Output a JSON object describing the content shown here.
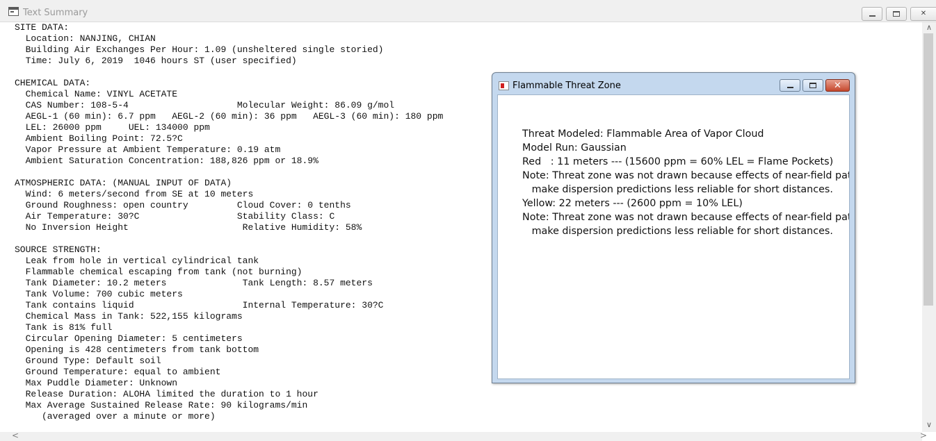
{
  "window": {
    "title": "Text Summary",
    "buttons": {
      "minimize": "minimize",
      "maximize": "maximize",
      "close": "close"
    }
  },
  "summary": {
    "site_header": "SITE DATA:",
    "location": "  Location: NANJING, CHIAN",
    "air_exchanges": "  Building Air Exchanges Per Hour: 1.09 (unsheltered single storied)",
    "time": "  Time: July 6, 2019  1046 hours ST (user specified)",
    "chemical_header": "CHEMICAL DATA:",
    "chemical_name": "  Chemical Name: VINYL ACETATE",
    "cas": "  CAS Number: 108-5-4                    Molecular Weight: 86.09 g/mol",
    "aegl": "  AEGL-1 (60 min): 6.7 ppm   AEGL-2 (60 min): 36 ppm   AEGL-3 (60 min): 180 ppm",
    "lel": "  LEL: 26000 ppm     UEL: 134000 ppm",
    "boiling_point": "  Ambient Boiling Point: 72.5?C",
    "vapor_pressure": "  Vapor Pressure at Ambient Temperature: 0.19 atm",
    "saturation": "  Ambient Saturation Concentration: 188,826 ppm or 18.9%",
    "atmospheric_header": "ATMOSPHERIC DATA: (MANUAL INPUT OF DATA)",
    "wind": "  Wind: 6 meters/second from SE at 10 meters",
    "roughness": "  Ground Roughness: open country         Cloud Cover: 0 tenths",
    "air_temp": "  Air Temperature: 30?C                  Stability Class: C",
    "inversion": "  No Inversion Height                     Relative Humidity: 58%",
    "source_header": "SOURCE STRENGTH:",
    "leak": "  Leak from hole in vertical cylindrical tank",
    "flammable": "  Flammable chemical escaping from tank (not burning)",
    "tank_diameter": "  Tank Diameter: 10.2 meters              Tank Length: 8.57 meters",
    "tank_volume": "  Tank Volume: 700 cubic meters",
    "tank_contains": "  Tank contains liquid                    Internal Temperature: 30?C",
    "chemical_mass": "  Chemical Mass in Tank: 522,155 kilograms",
    "tank_full": "  Tank is 81% full",
    "opening_diameter": "  Circular Opening Diameter: 5 centimeters",
    "opening_height": "  Opening is 428 centimeters from tank bottom",
    "ground_type": "  Ground Type: Default soil",
    "ground_temp": "  Ground Temperature: equal to ambient",
    "puddle": "  Max Puddle Diameter: Unknown",
    "release_duration": "  Release Duration: ALOHA limited the duration to 1 hour",
    "release_rate": "  Max Average Sustained Release Rate: 90 kilograms/min",
    "averaged": "     (averaged over a minute or more)"
  },
  "dialog": {
    "title": "Flammable Threat Zone",
    "lines": {
      "threat_modeled": "Threat Modeled: Flammable Area of Vapor Cloud",
      "model_run": "Model Run: Gaussian",
      "red": "Red   : 11 meters --- (15600 ppm = 60% LEL = Flame Pockets)",
      "note1_a": "Note: Threat zone was not drawn because effects of near-field patchiness",
      "note1_b": "   make dispersion predictions less reliable for short distances.",
      "yellow": "Yellow: 22 meters --- (2600 ppm = 10% LEL)",
      "note2_a": "Note: Threat zone was not drawn because effects of near-field patchiness",
      "note2_b": "   make dispersion predictions less reliable for short distances."
    }
  },
  "scrollbars": {
    "up": "∧",
    "down": "∨",
    "left": "<",
    "right": ">"
  }
}
